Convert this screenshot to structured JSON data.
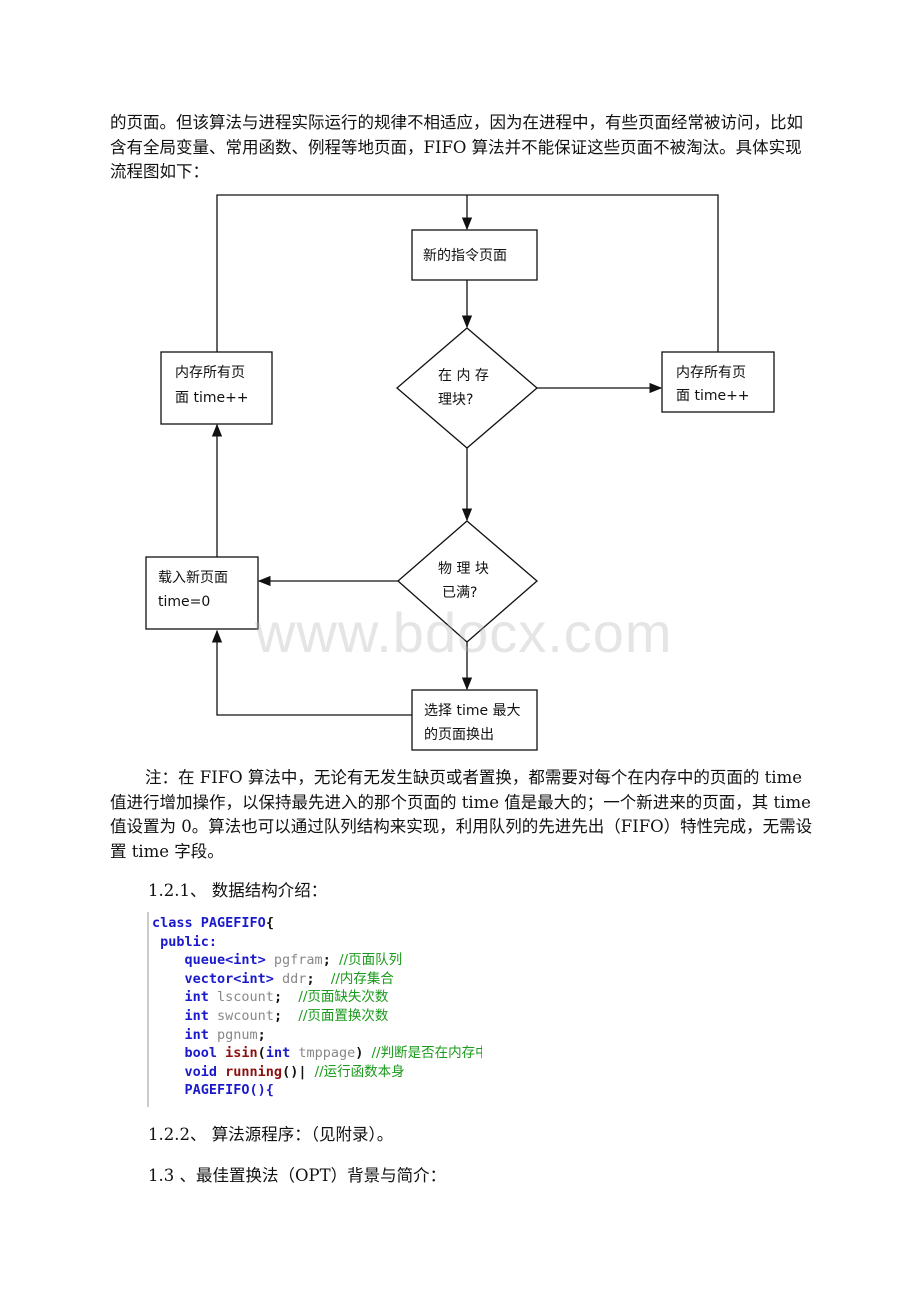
{
  "intro_paragraph": "的页面。但该算法与进程实际运行的规律不相适应，因为在进程中，有些页面经常被访问，比如含有全局变量、常用函数、例程等地页面，FIFO 算法并不能保证这些页面不被淘汰。具体实现流程图如下：",
  "flowchart": {
    "new_page": "新的指令页面",
    "in_memory_q_1": "在 内 存",
    "in_memory_q_2": "理块?",
    "left_top_box_1": "内存所有页",
    "left_top_box_2": "面 time++",
    "right_box_1": "内存所有页",
    "right_box_2": "面 time++",
    "full_q_1": "物 理 块",
    "full_q_2": "已满?",
    "load_box_1": "载入新页面",
    "load_box_2": "time=0",
    "select_box_1": "选择 time 最大",
    "select_box_2": "的页面换出"
  },
  "watermark": "www.bdocx.com",
  "note_paragraph": "注：在 FIFO 算法中，无论有无发生缺页或者置换，都需要对每个在内存中的页面的 time 值进行增加操作，以保持最先进入的那个页面的 time 值是最大的；一个新进来的页面，其 time 值设置为 0。算法也可以通过队列结构来实现，利用队列的先进先出（FIFO）特性完成，无需设置 time 字段。",
  "section_121": "1.2.1、 数据结构介绍：",
  "code": {
    "l1a": "class ",
    "l1b": "PAGEFIFO",
    "l1c": "{",
    "l2": " public:",
    "l3a": "    queue<int> ",
    "l3b": "pgfram",
    "l3c": "; ",
    "l3d": "//页面队列",
    "l4a": "    vector<int> ",
    "l4b": "ddr",
    "l4c": ";  ",
    "l4d": "//内存集合",
    "l5a": "    int ",
    "l5b": "lscount",
    "l5c": ";  ",
    "l5d": "//页面缺失次数",
    "l6a": "    int ",
    "l6b": "swcount",
    "l6c": ";  ",
    "l6d": "//页面置换次数",
    "l7a": "    int ",
    "l7b": "pgnum",
    "l7c": ";",
    "l8a": "    bool ",
    "l8b": "isin",
    "l8c": "(",
    "l8d": "int ",
    "l8e": "tmppage",
    "l8f": ") ",
    "l8g": "//判断是否在内存中的函数",
    "l9a": "    void ",
    "l9b": "running",
    "l9c": "()| ",
    "l9d": "//运行函数本身",
    "l10": "    PAGEFIFO(){"
  },
  "section_122": "1.2.2、 算法源程序：（见附录）。",
  "section_13": "1.3 、最佳置换法（OPT）背景与简介："
}
